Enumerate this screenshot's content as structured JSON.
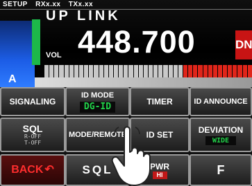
{
  "status_bar": {
    "setup": "SETUP",
    "rx": "RXx.xx",
    "tx": "TXx.xx"
  },
  "display": {
    "mode_title": "UP LINK",
    "vol_label": "VOL",
    "frequency": "448.700",
    "dn_badge": "DN",
    "a_indicator": "A"
  },
  "buttons": {
    "signaling": "SIGNALING",
    "id_mode": {
      "label": "ID MODE",
      "value": "DG-ID"
    },
    "timer": "TIMER",
    "id_announce": "ID ANNOUNCE",
    "sql": {
      "label": "SQL",
      "rx_type": "R-OFF",
      "tx_type": "T-OFF"
    },
    "mode_remote": "MODE/REMOTE",
    "id_set": "ID SET",
    "deviation": {
      "label": "DEVIATION",
      "value": "WIDE"
    },
    "back": "BACK",
    "sql_key": "SQL",
    "power": {
      "label": "PWR",
      "value": "HI"
    },
    "f_key": "F"
  },
  "colors": {
    "accent_green": "#22d34a",
    "back_red": "#ff2d2d",
    "dn_red": "#c81414",
    "a_blue": "#1c5de6"
  },
  "icons": {
    "back": "return-arrow-icon",
    "pointer": "tapping-hand-icon"
  }
}
